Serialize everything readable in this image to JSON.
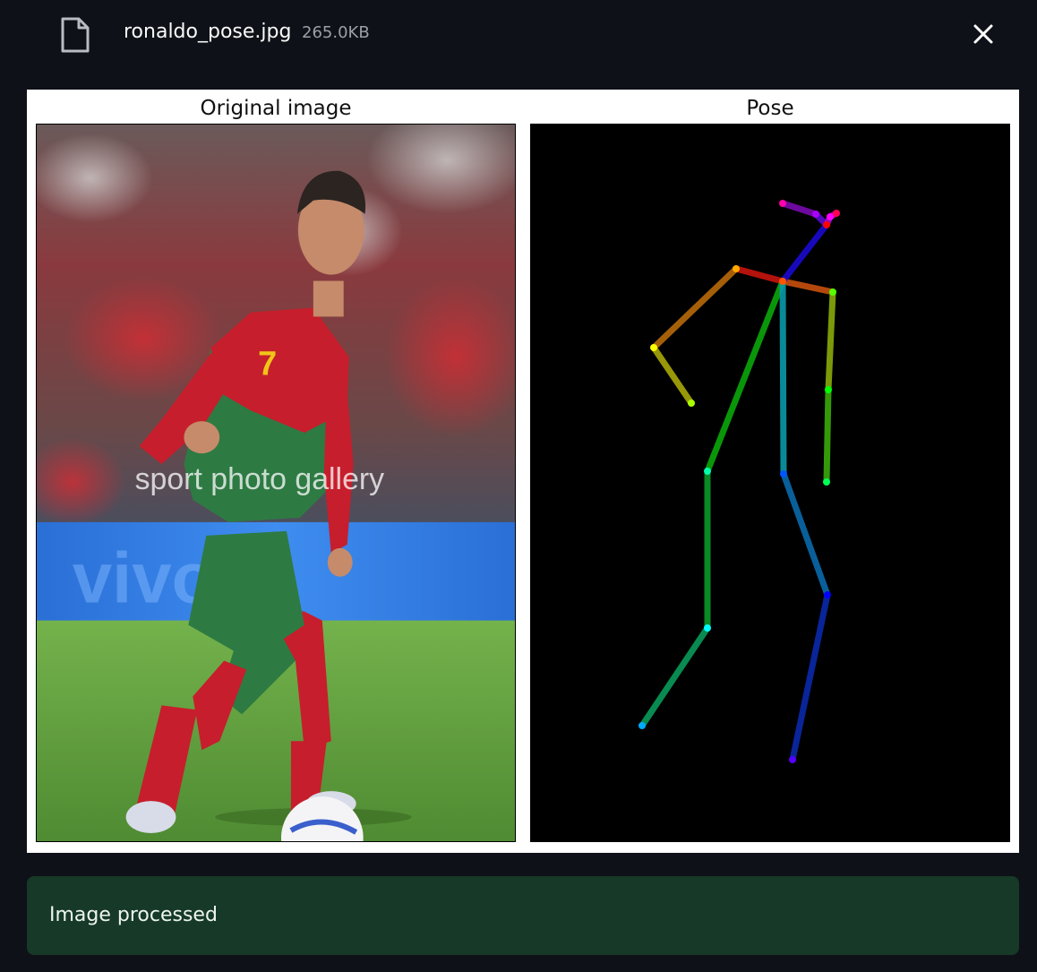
{
  "file": {
    "name": "ronaldo_pose.jpg",
    "size": "265.0KB",
    "icon": "file-icon",
    "close_icon": "close-icon"
  },
  "figure": {
    "left_title": "Original image",
    "right_title": "Pose",
    "photo_watermark": "sport photo gallery",
    "background": "#ffffff",
    "pose_background": "#000000"
  },
  "status": {
    "message": "Image processed",
    "background": "#173928"
  },
  "colors": {
    "page_background": "#0e1117",
    "text": "#fafafa",
    "muted_text": "#9aa0a8"
  }
}
